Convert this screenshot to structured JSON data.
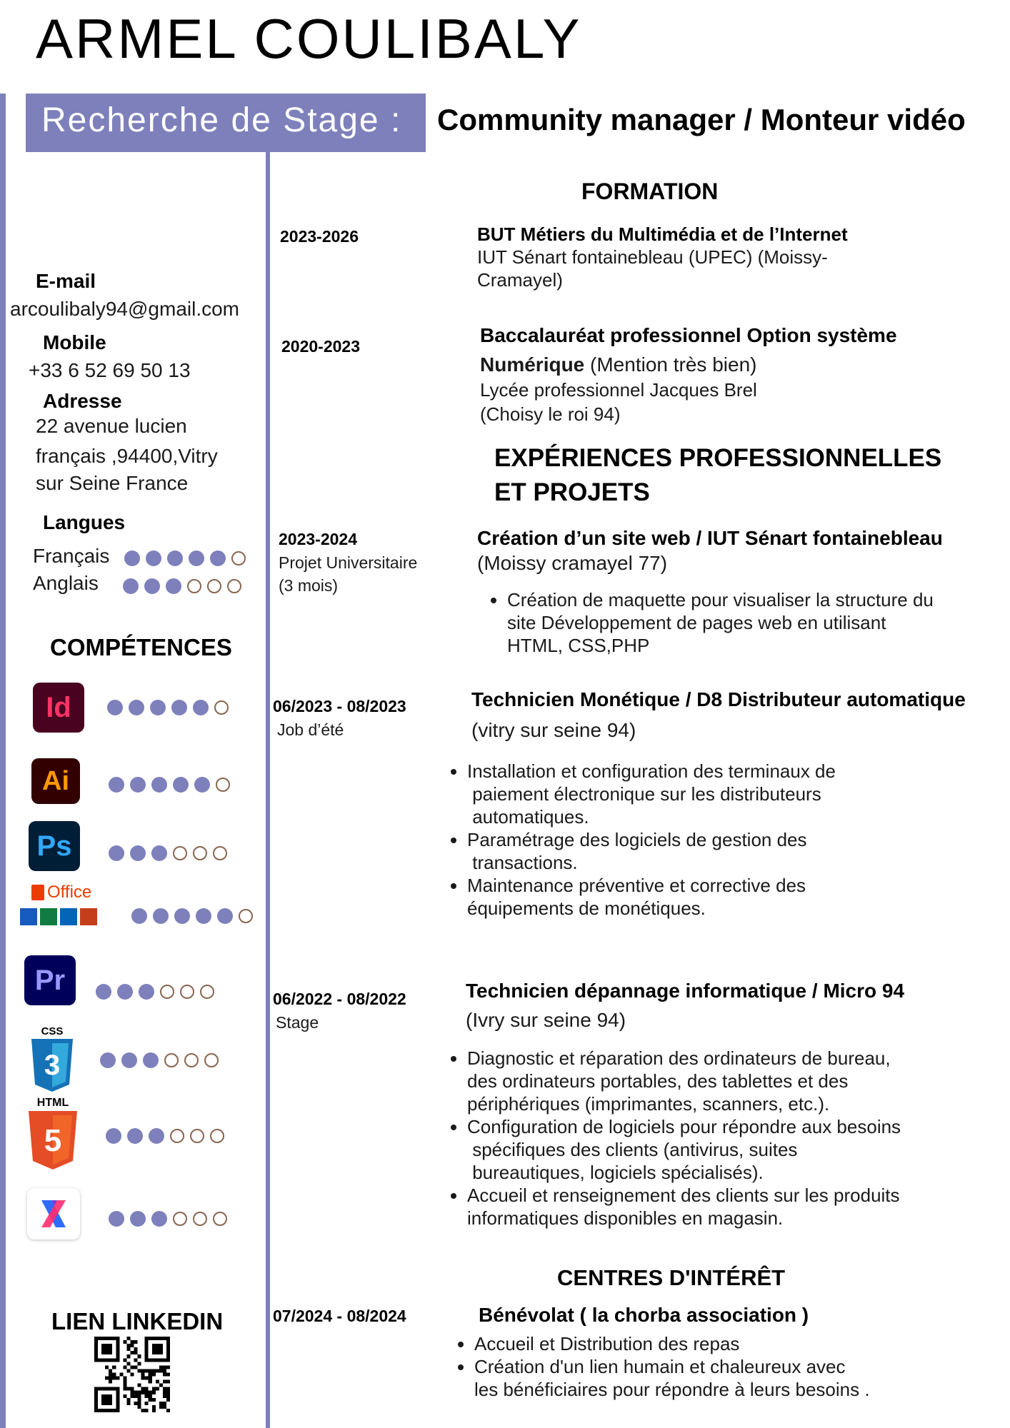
{
  "header": {
    "name": "ARMEL COULIBALY",
    "band_text": "Recherche de Stage :",
    "subtitle": "Community manager / Monteur vidéo"
  },
  "contact": {
    "email_label": "E-mail",
    "email": "arcoulibaly94@gmail.com",
    "mobile_label": "Mobile",
    "mobile": "+33 6 52 69 50 13",
    "address_label": "Adresse",
    "address_lines": [
      "22 avenue lucien",
      "français ,94400,Vitry",
      "sur Seine France"
    ]
  },
  "languages": {
    "title": "Langues",
    "items": [
      {
        "name": "Français",
        "level": 5,
        "max": 6
      },
      {
        "name": "Anglais",
        "level": 3,
        "max": 6
      }
    ]
  },
  "skills": {
    "title": "COMPÉTENCES",
    "items": [
      {
        "icon": "indesign-icon",
        "icon_text": "Id",
        "level": 5,
        "max": 6
      },
      {
        "icon": "illustrator-icon",
        "icon_text": "Ai",
        "level": 5,
        "max": 6
      },
      {
        "icon": "photoshop-icon",
        "icon_text": "Ps",
        "level": 3,
        "max": 6
      },
      {
        "icon": "office-icon",
        "icon_text": "Office",
        "level": 5,
        "max": 6
      },
      {
        "icon": "premiere-pro-icon",
        "icon_text": "Pr",
        "level": 3,
        "max": 6
      },
      {
        "icon": "css-icon",
        "icon_text": "CSS",
        "level": 3,
        "max": 6
      },
      {
        "icon": "html-icon",
        "icon_text": "HTML",
        "level": 3,
        "max": 6
      },
      {
        "icon": "xd-icon",
        "icon_text": "",
        "level": 3,
        "max": 6
      }
    ]
  },
  "linkedin": {
    "label": "LIEN LINKEDIN"
  },
  "formation": {
    "title": "FORMATION",
    "items": [
      {
        "date": "2023-2026",
        "title": "BUT Métiers du Multimédia et de l’Internet",
        "lines": [
          "IUT Sénart fontainebleau (UPEC) (Moissy-",
          "Cramayel)"
        ]
      },
      {
        "date": "2020-2023",
        "title_line1": "Baccalauréat professionnel Option système",
        "title_line2_bold": "Numérique",
        "title_line2_rest": " (Mention très bien)",
        "lines": [
          "Lycée professionnel Jacques Brel",
          "(Choisy le roi 94)"
        ]
      }
    ]
  },
  "experience": {
    "title_line1": "EXPÉRIENCES PROFESSIONNELLES",
    "title_line2": "ET PROJETS",
    "items": [
      {
        "date": "2023-2024",
        "sub": [
          " Projet  Universitaire",
          "(3 mois)"
        ],
        "title": "Création d’un site web / IUT Sénart fontainebleau",
        "location": "(Moissy cramayel 77)",
        "bullets": [
          "Création de maquette pour visualiser la structure du\nsite Développement de pages web en utilisant\nHTML, CSS,PHP"
        ]
      },
      {
        "date": "06/2023 - 08/2023",
        "sub": [
          "Job d’été"
        ],
        "title": "Technicien Monétique / D8 Distributeur automatique",
        "location": "(vitry sur seine 94)",
        "bullets": [
          "Installation et configuration des terminaux de\n paiement électronique sur les distributeurs\n automatiques.",
          "Paramétrage des logiciels de gestion des\n transactions.",
          "Maintenance préventive et corrective des\néquipements de monétiques."
        ]
      },
      {
        "date": "06/2022 - 08/2022",
        "sub": [
          " Stage"
        ],
        "title": "Technicien dépannage informatique / Micro 94",
        "location": "(Ivry sur seine 94)",
        "bullets": [
          "Diagnostic et réparation des ordinateurs de bureau,\ndes ordinateurs portables, des tablettes et des\npériphériques (imprimantes, scanners, etc.).",
          "Configuration de logiciels pour répondre aux besoins\n spécifiques des clients (antivirus, suites\n bureautiques, logiciels spécialisés).",
          "Accueil et renseignement des clients sur les produits\ninformatiques disponibles en magasin."
        ]
      }
    ]
  },
  "interests": {
    "title": "CENTRES D'INTÉRÊT",
    "date": "07/2024 - 08/2024",
    "subtitle": "Bénévolat ( la chorba association )",
    "bullets": [
      "Accueil et Distribution des repas",
      "Création d'un lien humain et chaleureux avec\nles bénéficiaires pour répondre à leurs besoins ."
    ]
  },
  "colors": {
    "accent": "#7e80bb",
    "empty_dot_border": "#8a6650"
  }
}
